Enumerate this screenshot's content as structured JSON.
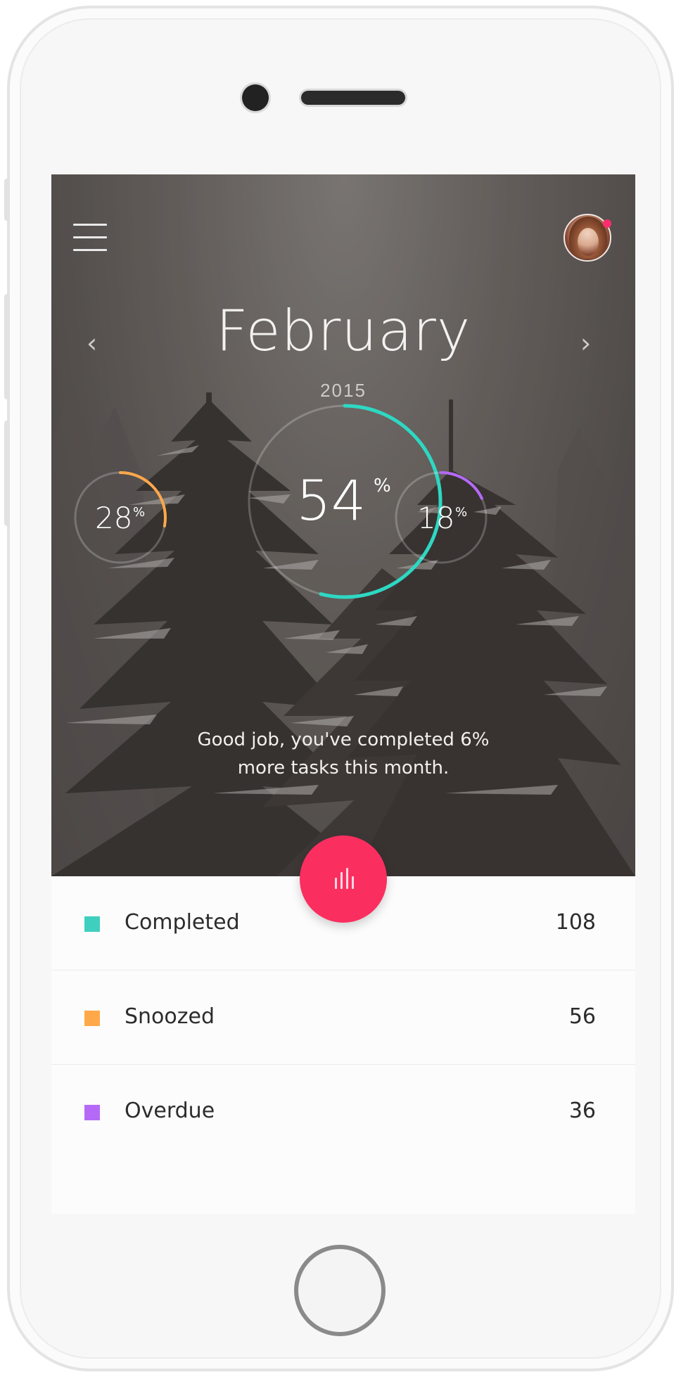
{
  "header": {
    "month": "February",
    "year": "2015",
    "prev_arrow": "‹",
    "next_arrow": "›",
    "menu_icon": "hamburger-menu-icon",
    "avatar_icon": "user-avatar"
  },
  "stats": {
    "main": {
      "value": "54",
      "unit": "%",
      "fraction": 0.54,
      "color": "#2ed8c3"
    },
    "left": {
      "value": "28",
      "unit": "%",
      "fraction": 0.28,
      "color": "#ffa84a"
    },
    "right": {
      "value": "18",
      "unit": "%",
      "fraction": 0.18,
      "color": "#b56af7"
    }
  },
  "message": {
    "line1": "Good job, you've completed 6%",
    "line2": "more tasks this month."
  },
  "fab": {
    "icon": "bar-chart-icon",
    "color": "#fb2e60"
  },
  "list": [
    {
      "label": "Completed",
      "count": "108",
      "color": "#3fcfbf"
    },
    {
      "label": "Snoozed",
      "count": "56",
      "color": "#ffa84a"
    },
    {
      "label": "Overdue",
      "count": "36",
      "color": "#b56af7"
    }
  ]
}
